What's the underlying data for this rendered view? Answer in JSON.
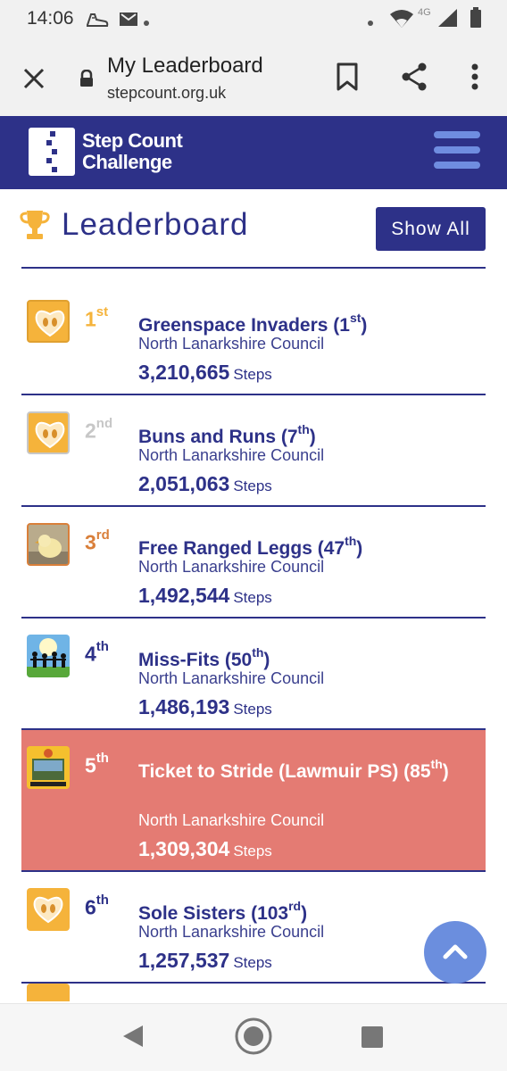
{
  "status_bar": {
    "time": "14:06",
    "network": "4G"
  },
  "browser": {
    "page_title": "My Leaderboard",
    "url": "stepcount.org.uk"
  },
  "site": {
    "logo_line1": "Step Count",
    "logo_line2": "Challenge"
  },
  "leaderboard": {
    "title": "Leaderboard",
    "show_all_label": "Show All"
  },
  "teams": [
    {
      "rank": "1",
      "rank_suffix": "st",
      "name": "Greenspace Invaders",
      "overall_rank": "1",
      "overall_suffix": "st",
      "org": "North Lanarkshire Council",
      "steps": "3,210,665",
      "steps_unit": "Steps"
    },
    {
      "rank": "2",
      "rank_suffix": "nd",
      "name": "Buns and Runs",
      "overall_rank": "7",
      "overall_suffix": "th",
      "org": "North Lanarkshire Council",
      "steps": "2,051,063",
      "steps_unit": "Steps"
    },
    {
      "rank": "3",
      "rank_suffix": "rd",
      "name": "Free Ranged Leggs",
      "overall_rank": "47",
      "overall_suffix": "th",
      "org": "North Lanarkshire Council",
      "steps": "1,492,544",
      "steps_unit": "Steps"
    },
    {
      "rank": "4",
      "rank_suffix": "th",
      "name": "Miss-Fits",
      "overall_rank": "50",
      "overall_suffix": "th",
      "org": "North Lanarkshire Council",
      "steps": "1,486,193",
      "steps_unit": "Steps"
    },
    {
      "rank": "5",
      "rank_suffix": "th",
      "name": "Ticket to Stride (Lawmuir PS)",
      "overall_rank": "85",
      "overall_suffix": "th",
      "org": "North Lanarkshire Council",
      "steps": "1,309,304",
      "steps_unit": "Steps"
    },
    {
      "rank": "6",
      "rank_suffix": "th",
      "name": "Sole Sisters",
      "overall_rank": "103",
      "overall_suffix": "rd",
      "org": "North Lanarkshire Council",
      "steps": "1,257,537",
      "steps_unit": "Steps"
    }
  ],
  "colors": {
    "brand_navy": "#2d3188",
    "highlight_row": "#e47b73",
    "gold": "#f5b33b",
    "silver": "#c7c7c7",
    "bronze": "#d97f3a",
    "accent_blue": "#6b8ede"
  },
  "icons": [
    "walking-shoe-icon",
    "gmail-icon",
    "wifi-icon",
    "signal-icon",
    "battery-icon",
    "close-icon",
    "lock-icon",
    "bookmark-icon",
    "share-icon",
    "more-vert-icon",
    "menu-icon",
    "trophy-icon",
    "chevron-up-icon",
    "back-icon",
    "home-icon",
    "recents-icon"
  ]
}
